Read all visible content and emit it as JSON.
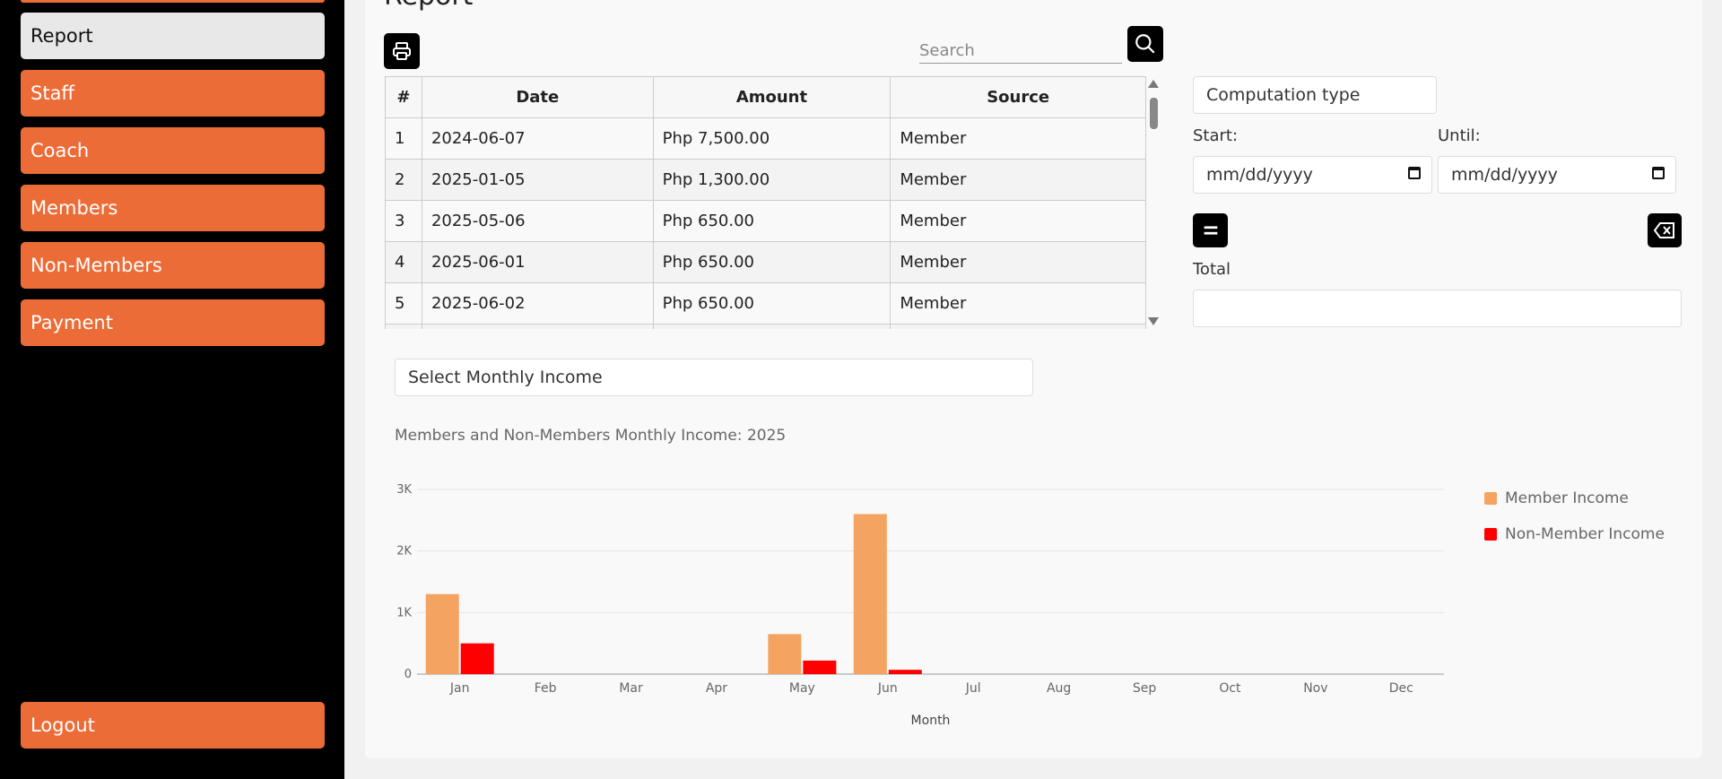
{
  "sidebar": {
    "items": [
      {
        "label": "Report",
        "active": true
      },
      {
        "label": "Staff"
      },
      {
        "label": "Coach"
      },
      {
        "label": "Members"
      },
      {
        "label": "Non-Members"
      },
      {
        "label": "Payment"
      }
    ],
    "logout_label": "Logout"
  },
  "main": {
    "title": "Report",
    "search": {
      "placeholder": "Search",
      "value": ""
    },
    "table": {
      "headers": [
        "#",
        "Date",
        "Amount",
        "Source"
      ],
      "rows": [
        [
          "1",
          "2024-06-07",
          "Php 7,500.00",
          "Member"
        ],
        [
          "2",
          "2025-01-05",
          "Php 1,300.00",
          "Member"
        ],
        [
          "3",
          "2025-05-06",
          "Php 650.00",
          "Member"
        ],
        [
          "4",
          "2025-06-01",
          "Php 650.00",
          "Member"
        ],
        [
          "5",
          "2025-06-02",
          "Php 650.00",
          "Member"
        ]
      ]
    },
    "computation": {
      "type_label": "Computation type",
      "start_label": "Start:",
      "until_label": "Until:",
      "start_value": "mm/dd/yyyy",
      "until_value": "mm/dd/yyyy",
      "total_label": "Total",
      "total_value": ""
    },
    "monthly_select_label": "Select Monthly Income",
    "icons": {
      "print": "printer-icon",
      "search": "search-icon",
      "equals": "equals-icon",
      "clear": "backspace-icon",
      "calendar": "calendar-icon"
    }
  },
  "colors": {
    "accent": "#ec6c38",
    "member_income": "#f4a460",
    "non_member_income": "#ff0000"
  },
  "chart_data": {
    "type": "bar",
    "title": "Members and Non-Members Monthly Income: 2025",
    "xlabel": "Month",
    "ylabel": "",
    "ylim": [
      0,
      3000
    ],
    "yticks": [
      "0",
      "1K",
      "2K",
      "3K"
    ],
    "grid": true,
    "legend": "right",
    "categories": [
      "Jan",
      "Feb",
      "Mar",
      "Apr",
      "May",
      "Jun",
      "Jul",
      "Aug",
      "Sep",
      "Oct",
      "Nov",
      "Dec"
    ],
    "series": [
      {
        "name": "Member Income",
        "color": "#f4a460",
        "values": [
          1300,
          0,
          0,
          0,
          650,
          2600,
          0,
          0,
          0,
          0,
          0,
          0
        ]
      },
      {
        "name": "Non-Member Income",
        "color": "#ff0000",
        "values": [
          500,
          0,
          0,
          0,
          220,
          70,
          0,
          0,
          0,
          0,
          0,
          0
        ]
      }
    ]
  }
}
